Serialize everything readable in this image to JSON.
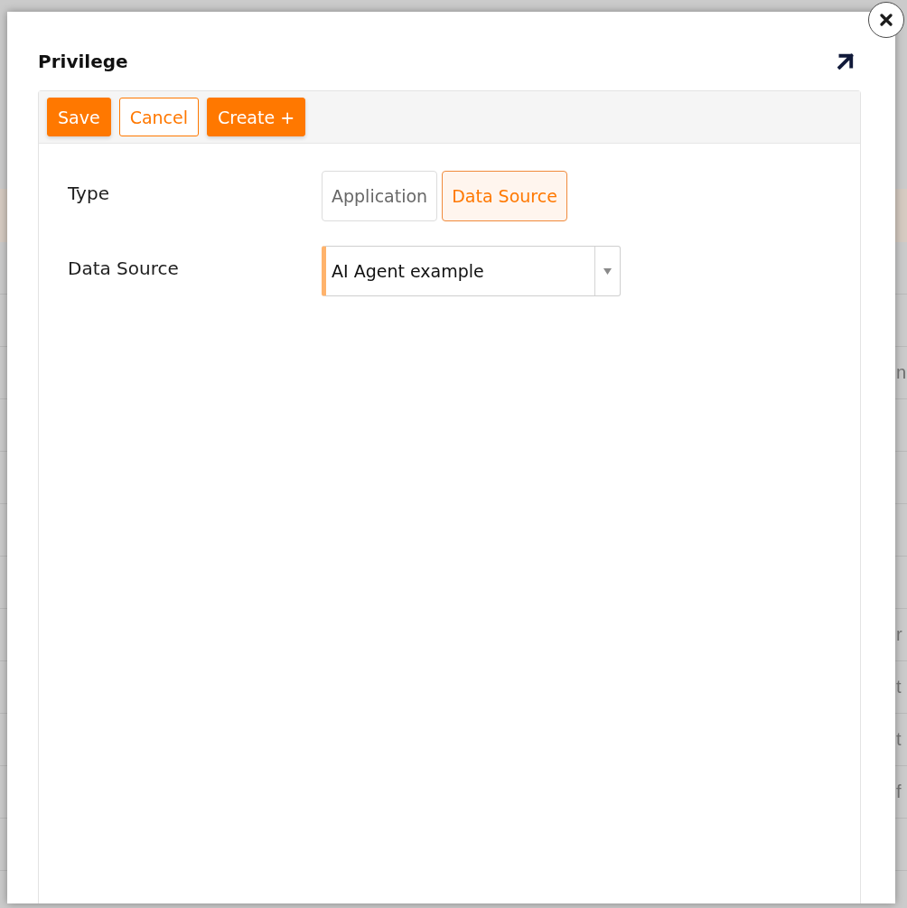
{
  "dialog": {
    "title": "Privilege"
  },
  "toolbar": {
    "buttons": [
      {
        "label": "Save",
        "kind": "primary"
      },
      {
        "label": "Cancel",
        "kind": "outline"
      },
      {
        "label": "Create +",
        "kind": "primary"
      }
    ]
  },
  "form": {
    "fields": [
      {
        "label": "Type",
        "kind": "toggle",
        "options": [
          {
            "label": "Application",
            "selected": false
          },
          {
            "label": "Data Source",
            "selected": true
          }
        ]
      },
      {
        "label": "Data Source",
        "kind": "select",
        "value": "AI Agent example",
        "required": true
      }
    ]
  },
  "background_table": {
    "rows": [
      {},
      {},
      {
        "column_1": "n"
      },
      {},
      {},
      {},
      {},
      {
        "column_1": "r"
      },
      {
        "column_1": "t"
      },
      {
        "column_1": "t"
      },
      {
        "column_1": "f"
      },
      {},
      {}
    ]
  }
}
